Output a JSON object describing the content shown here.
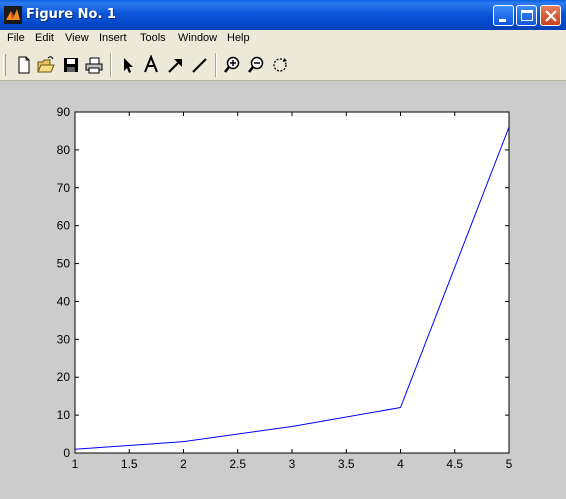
{
  "window": {
    "title": "Figure No. 1",
    "icon": "matlab-icon"
  },
  "menu": {
    "items": [
      "File",
      "Edit",
      "View",
      "Insert",
      "Tools",
      "Window",
      "Help"
    ]
  },
  "toolbar": {
    "buttons": [
      "new-file-icon",
      "open-folder-icon",
      "save-icon",
      "print-icon",
      "select-arrow-icon",
      "insert-text-icon",
      "insert-arrow-icon",
      "insert-line-icon",
      "zoom-in-icon",
      "zoom-out-icon",
      "rotate-icon"
    ]
  },
  "chart_data": {
    "type": "line",
    "x": [
      1,
      2,
      3,
      4,
      5
    ],
    "series": [
      {
        "values": [
          1,
          3,
          7,
          12,
          86
        ],
        "color": "#0000ff"
      }
    ],
    "xlim": [
      1,
      5
    ],
    "ylim": [
      0,
      90
    ],
    "xticks": [
      "1",
      "1.5",
      "2",
      "2.5",
      "3",
      "3.5",
      "4",
      "4.5",
      "5"
    ],
    "yticks": [
      "0",
      "10",
      "20",
      "30",
      "40",
      "50",
      "60",
      "70",
      "80",
      "90"
    ],
    "grid": false
  }
}
